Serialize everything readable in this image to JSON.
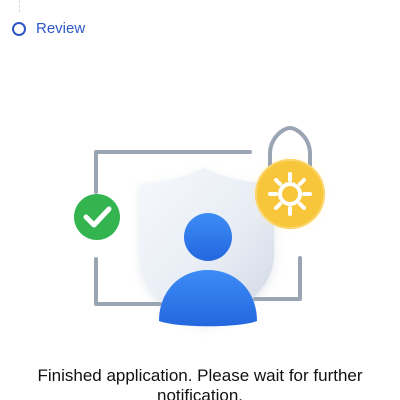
{
  "step": {
    "label": "Review",
    "icon": "circle-step-icon",
    "accent": "#2f57c8"
  },
  "illustration": {
    "icons": [
      "frame-icon",
      "shield-icon",
      "user-icon",
      "check-icon",
      "lock-icon",
      "sun-icon"
    ],
    "colors": {
      "check": "#2fb24a",
      "lock": "#f6c23a",
      "user": "#2e7cf0",
      "shield": "#e4eaf3"
    }
  },
  "message": {
    "text": "Finished application. Please wait for further notification."
  }
}
